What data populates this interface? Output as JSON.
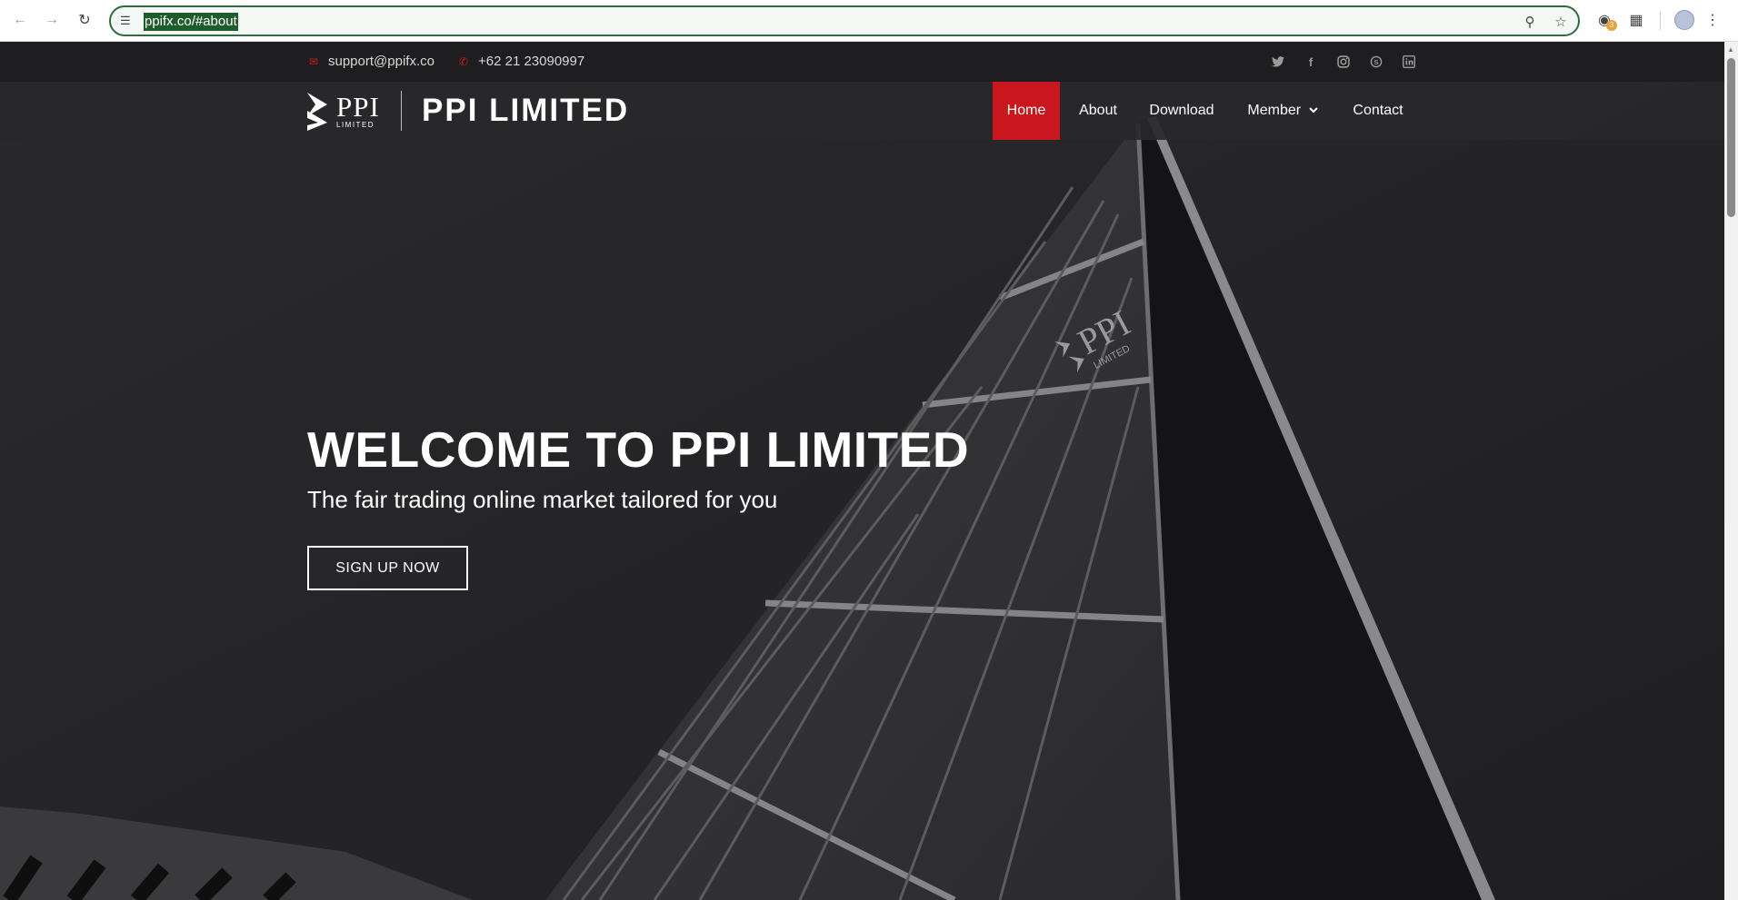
{
  "browser": {
    "url": "ppifx.co/#about",
    "extension_badge": "3",
    "icons": {
      "back": "arrow-left-icon",
      "forward": "arrow-right-icon",
      "reload": "reload-icon",
      "site_info": "tune-icon",
      "zoom": "zoom-icon",
      "bookmark": "star-icon",
      "extension": "extension-shield-icon",
      "extensions_menu": "puzzle-icon",
      "profile": "avatar",
      "menu": "kebab-menu-icon"
    }
  },
  "topbar": {
    "email": "support@ppifx.co",
    "phone": "+62 21 23090997",
    "social": [
      "twitter",
      "facebook",
      "instagram",
      "skype",
      "linkedin"
    ]
  },
  "nav": {
    "logo_text": "PPI",
    "logo_subtext": "LIMITED",
    "brand": "PPI LIMITED",
    "items": [
      {
        "label": "Home",
        "active": true
      },
      {
        "label": "About",
        "active": false
      },
      {
        "label": "Download",
        "active": false
      },
      {
        "label": "Member",
        "active": false,
        "dropdown": true
      },
      {
        "label": "Contact",
        "active": false
      }
    ]
  },
  "hero": {
    "title": "WELCOME TO PPI LIMITED",
    "subtitle": "The fair trading online market tailored for you",
    "cta": "SIGN UP NOW"
  },
  "colors": {
    "accent": "#c9171d",
    "nav_bg": "#28282a",
    "topbar_bg": "#1e1e20",
    "hero_bg": "#262628",
    "text": "#ffffff"
  }
}
